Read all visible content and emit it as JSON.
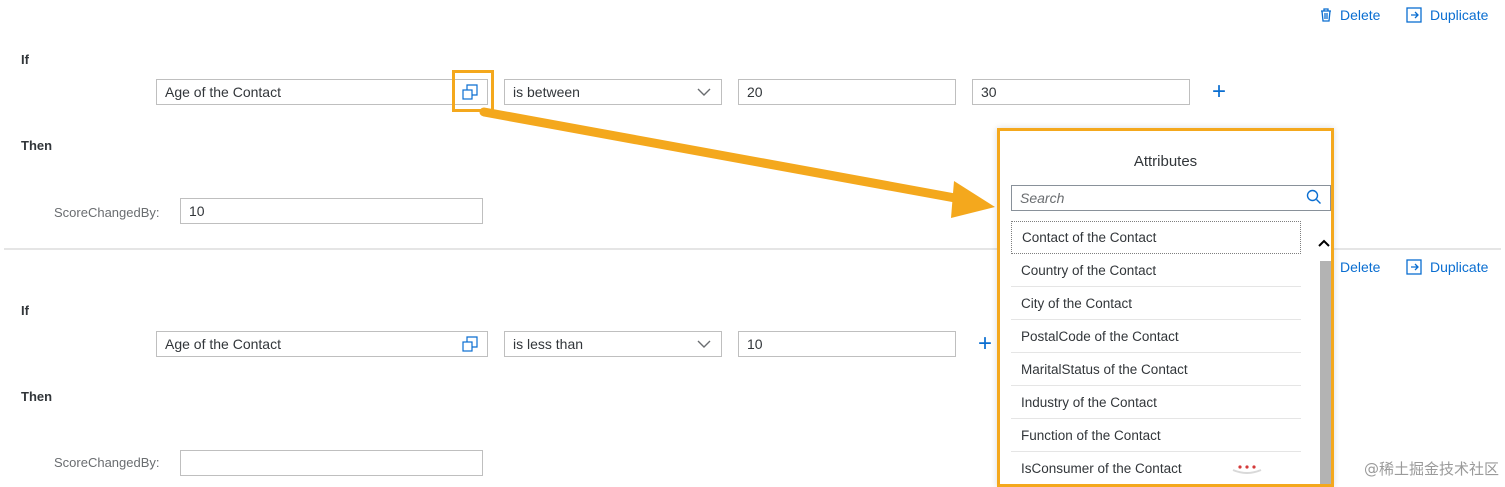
{
  "actions": {
    "delete_label": "Delete",
    "duplicate_label": "Duplicate"
  },
  "rule1": {
    "if_label": "If",
    "attribute": "Age of the Contact",
    "operator": "is between",
    "value1": "20",
    "value2": "30",
    "then_label": "Then",
    "score_label": "ScoreChangedBy:",
    "score_value": "10"
  },
  "rule2": {
    "if_label": "If",
    "attribute": "Age of the Contact",
    "operator": "is less than",
    "value1": "10",
    "then_label": "Then",
    "score_label": "ScoreChangedBy:",
    "score_value": ""
  },
  "popup": {
    "title": "Attributes",
    "search_placeholder": "Search",
    "items": [
      "Contact of the Contact",
      "Country of the Contact",
      "City of the Contact",
      "PostalCode of the Contact",
      "MaritalStatus of the Contact",
      "Industry of the Contact",
      "Function of the Contact",
      "IsConsumer of the Contact"
    ]
  },
  "watermark": "@稀土掘金技术社区",
  "colors": {
    "accent": "#0a6ed1",
    "highlight": "#f4a81d"
  },
  "icons": {
    "delete": "trash-icon",
    "duplicate": "duplicate-icon",
    "value_help": "value-help-icon",
    "dropdown": "chevron-down-icon",
    "add": "plus-icon",
    "search": "search-icon"
  }
}
